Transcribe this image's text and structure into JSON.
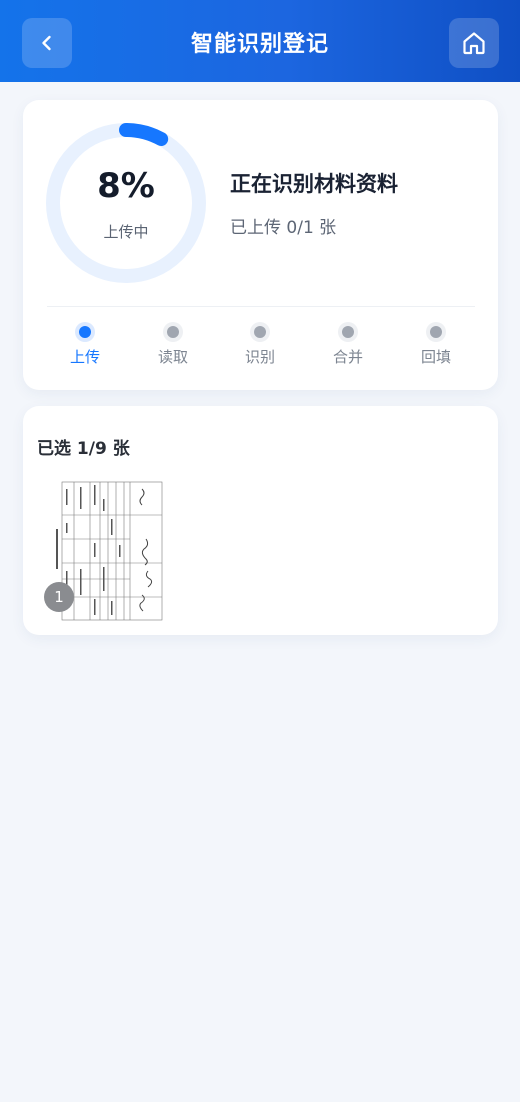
{
  "colors": {
    "primary": "#1677ff",
    "ring_track": "#e8f1fe",
    "inactive_dot": "#a0a6b0",
    "inactive_dot_ring": "#eef0f3",
    "active_dot_ring": "#dbe9ff",
    "inactive_label": "#7d8591",
    "active_label": "#1677ff"
  },
  "header": {
    "title": "智能识别登记",
    "back_icon": "chevron-left-icon",
    "home_icon": "home-icon"
  },
  "progress": {
    "percent_value": 8,
    "percent_label": "8%",
    "state_label": "上传中",
    "title": "正在识别材料资料",
    "subtitle": "已上传 0/1 张"
  },
  "steps": [
    {
      "label": "上传",
      "active": true
    },
    {
      "label": "读取",
      "active": false
    },
    {
      "label": "识别",
      "active": false
    },
    {
      "label": "合并",
      "active": false
    },
    {
      "label": "回填",
      "active": false
    }
  ],
  "selection": {
    "title": "已选 1/9 张",
    "items": [
      {
        "index_label": "1",
        "kind": "document-thumbnail"
      }
    ]
  }
}
